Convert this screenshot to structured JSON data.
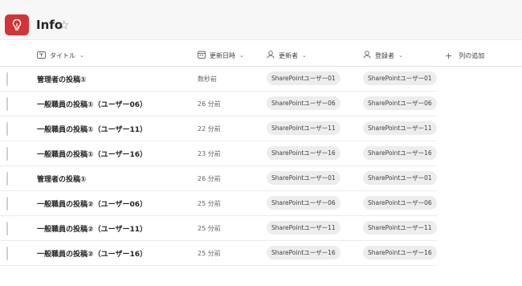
{
  "list": {
    "title": "Info",
    "star_icon": "☆"
  },
  "columns": {
    "title": "タイトル",
    "modified": "更新日時",
    "editor": "更新者",
    "author": "登録者",
    "add": "列の追加"
  },
  "rows": [
    {
      "title": "管理者の投稿①",
      "modified": "数秒前",
      "editor": "SharePointユーザー01",
      "author": "SharePointユーザー01"
    },
    {
      "title": "一般職員の投稿①（ユーザー06）",
      "modified": "26 分前",
      "editor": "SharePointユーザー06",
      "author": "SharePointユーザー06"
    },
    {
      "title": "一般職員の投稿①（ユーザー11）",
      "modified": "22 分前",
      "editor": "SharePointユーザー11",
      "author": "SharePointユーザー11"
    },
    {
      "title": "一般職員の投稿①（ユーザー16）",
      "modified": "23 分前",
      "editor": "SharePointユーザー16",
      "author": "SharePointユーザー16"
    },
    {
      "title": "管理者の投稿①",
      "modified": "26 分前",
      "editor": "SharePointユーザー01",
      "author": "SharePointユーザー01"
    },
    {
      "title": "一般職員の投稿②（ユーザー06）",
      "modified": "25 分前",
      "editor": "SharePointユーザー06",
      "author": "SharePointユーザー06"
    },
    {
      "title": "一般職員の投稿②（ユーザー11）",
      "modified": "25 分前",
      "editor": "SharePointユーザー11",
      "author": "SharePointユーザー11"
    },
    {
      "title": "一般職員の投稿②（ユーザー16）",
      "modified": "25 分前",
      "editor": "SharePointユーザー16",
      "author": "SharePointユーザー16"
    }
  ],
  "icons": {
    "app": "lightbulb-icon",
    "title_column": "text-field-icon",
    "modified_column": "calendar-icon",
    "editor_column": "person-icon",
    "author_column": "person-icon",
    "add_column": "plus-icon",
    "sort": "chevron-down-icon"
  },
  "colors": {
    "app_icon": "#d13438",
    "pill_background": "#ededed"
  }
}
